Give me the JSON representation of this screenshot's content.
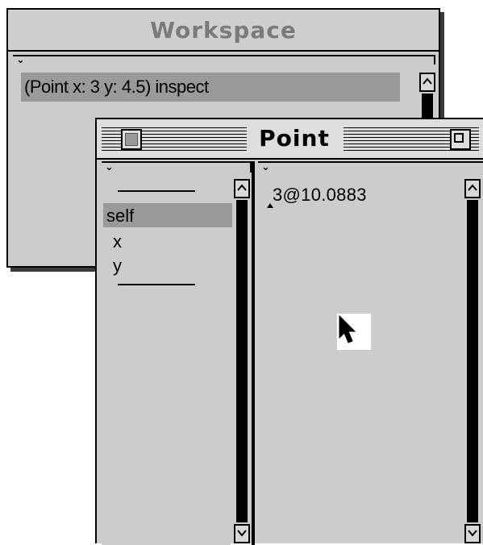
{
  "workspace": {
    "title": "Workspace",
    "menu_glyph": "⌄",
    "text_line": "(Point x: 3 y: 4.5) inspect"
  },
  "point_window": {
    "title": "Point",
    "left_pane": {
      "menu_glyph": "⌄",
      "items": [
        "self",
        "x",
        "y"
      ],
      "selected": "self"
    },
    "right_pane": {
      "menu_glyph": "⌄",
      "value": "3@10.0883"
    }
  },
  "icons": {
    "scroll_up": "▲",
    "scroll_down": "▼",
    "cursor": "arrow-pointer-icon"
  }
}
